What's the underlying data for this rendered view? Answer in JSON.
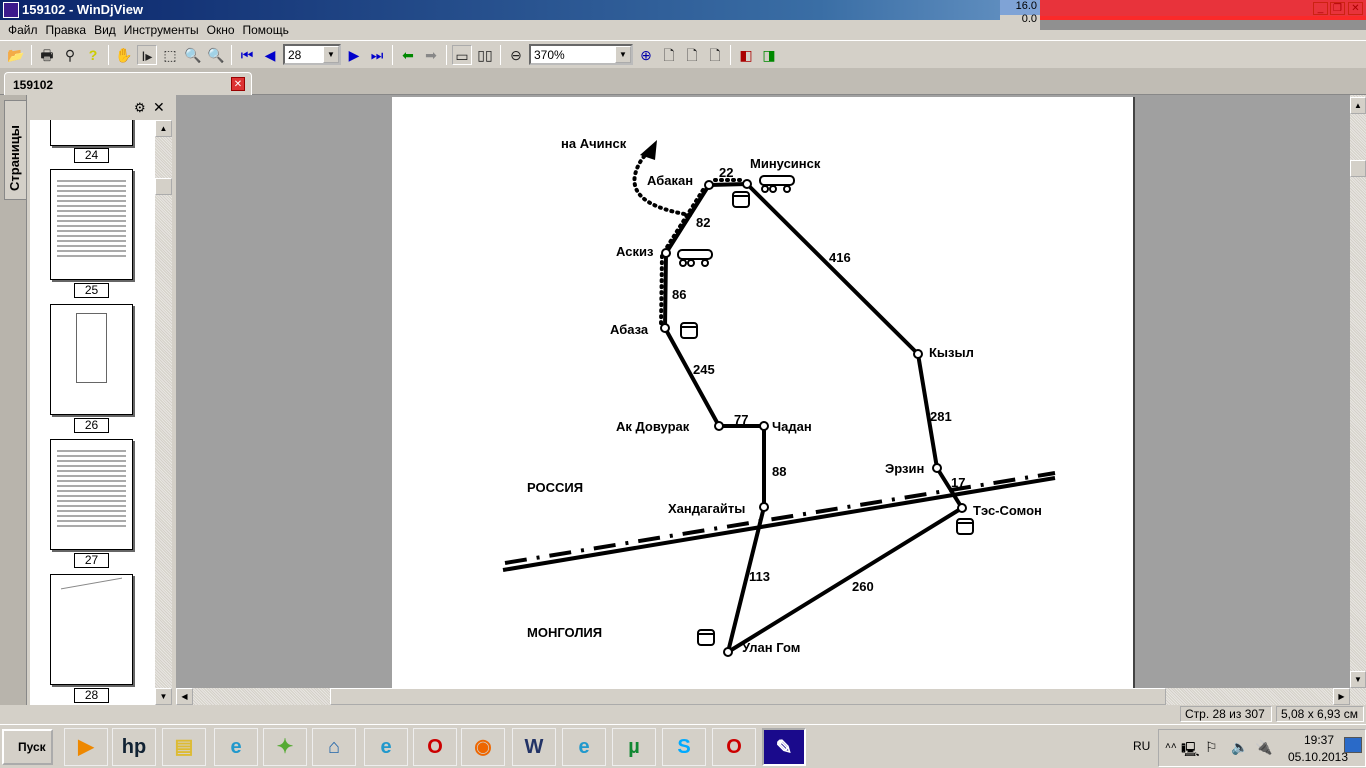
{
  "window": {
    "title": "159102 - WinDjView",
    "perf_max": "16.0",
    "perf_min": "0.0"
  },
  "menu": [
    "Файл",
    "Правка",
    "Вид",
    "Инструменты",
    "Окно",
    "Помощь"
  ],
  "toolbar": {
    "page_value": "28",
    "zoom_value": "370%"
  },
  "tab": {
    "label": "159102"
  },
  "sidebar": {
    "tab_label": "Страницы",
    "thumbnails": [
      "24",
      "25",
      "26",
      "27",
      "28"
    ]
  },
  "map": {
    "cities": [
      "Абакан",
      "Минусинск",
      "Аскиз",
      "Абаза",
      "Ак Довурак",
      "Чадан",
      "Хандагайты",
      "Кызыл",
      "Эрзин",
      "Тэс-Сомон",
      "Улан Гом"
    ],
    "direction_label": "на Ачинск",
    "countries": [
      "РОССИЯ",
      "МОНГОЛИЯ"
    ],
    "distances": [
      "22",
      "82",
      "416",
      "86",
      "245",
      "77",
      "88",
      "281",
      "17",
      "113",
      "260"
    ]
  },
  "status": {
    "page": "Стр. 28 из 307",
    "size": "5,08 x 6,93 см"
  },
  "taskbar": {
    "start_label": "Пуск",
    "language": "RU",
    "time": "19:37",
    "date": "05.10.2013",
    "apps": [
      "media-player",
      "hp",
      "file-explorer",
      "internet-explorer",
      "messenger",
      "network",
      "internet-explorer",
      "opera",
      "firefox",
      "word",
      "internet-explorer",
      "utorrent",
      "skype",
      "opera-browser",
      "windjview"
    ]
  }
}
